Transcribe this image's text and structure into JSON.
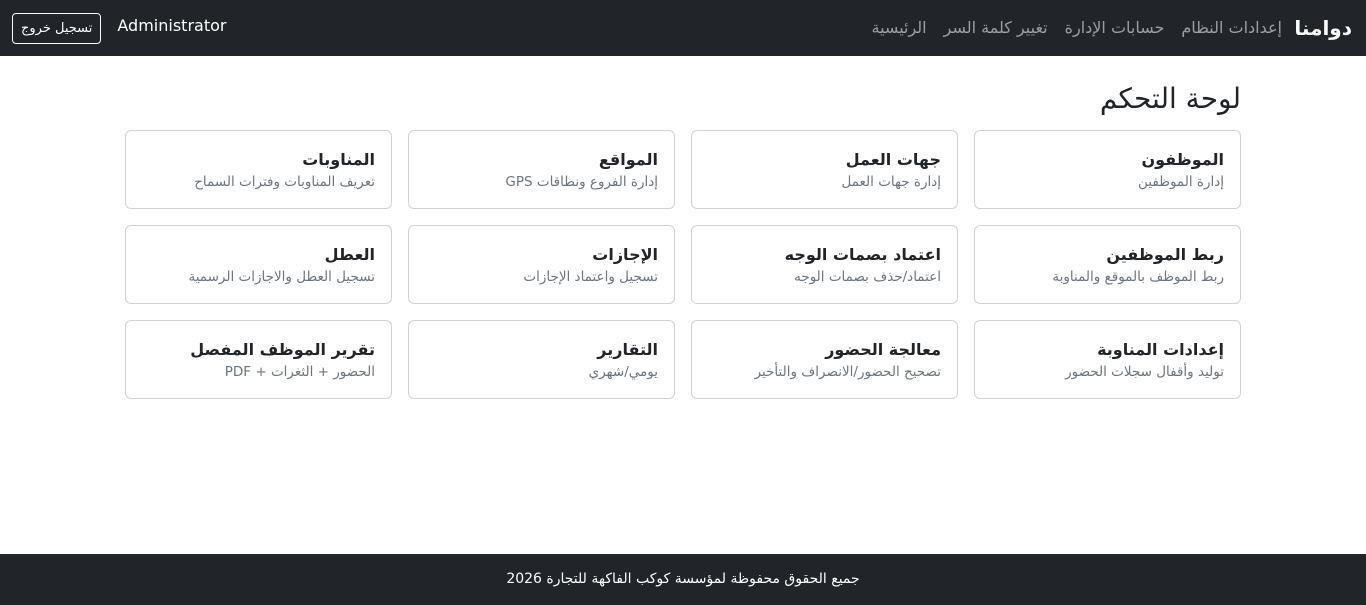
{
  "navbar": {
    "brand": "دوامنا",
    "links": [
      {
        "label": "الرئيسية"
      },
      {
        "label": "تغيير كلمة السر"
      },
      {
        "label": "حسابات الإدارة"
      },
      {
        "label": "إعدادات النظام"
      }
    ],
    "user": "Administrator",
    "logout_label": "تسجيل خروج"
  },
  "main": {
    "title": "لوحة التحكم",
    "cards": [
      {
        "title": "الموظفون",
        "desc": "إدارة الموظفين"
      },
      {
        "title": "جهات العمل",
        "desc": "إدارة جهات العمل"
      },
      {
        "title": "المواقع",
        "desc": "إدارة الفروع ونطاقات GPS"
      },
      {
        "title": "المناوبات",
        "desc": "تعريف المناوبات وفترات السماح"
      },
      {
        "title": "ربط الموظفين",
        "desc": "ربط الموظف بالموقع والمناوبة"
      },
      {
        "title": "اعتماد بصمات الوجه",
        "desc": "اعتماد/حذف بصمات الوجه"
      },
      {
        "title": "الإجازات",
        "desc": "تسجيل واعتماد الإجازات"
      },
      {
        "title": "العطل",
        "desc": "تسجيل العطل والاجازات الرسمية"
      },
      {
        "title": "إعدادات المناوبة",
        "desc": "توليد وأقفال سجلات الحضور"
      },
      {
        "title": "معالجة الحضور",
        "desc": "تصحيح الحضور/الانصراف والتأخير"
      },
      {
        "title": "التقارير",
        "desc": "يومي/شهري"
      },
      {
        "title": "تقرير الموظف المفصل",
        "desc": "الحضور + الثغرات + PDF"
      }
    ]
  },
  "footer": {
    "text": "جميع الحقوق محفوظة لمؤسسة كوكب الفاكهة للتجارة 2026"
  },
  "colors": {
    "navbar_bg": "#212529",
    "footer_bg": "#212529",
    "muted_text": "#6c757d",
    "card_border": "#dee2e6"
  }
}
